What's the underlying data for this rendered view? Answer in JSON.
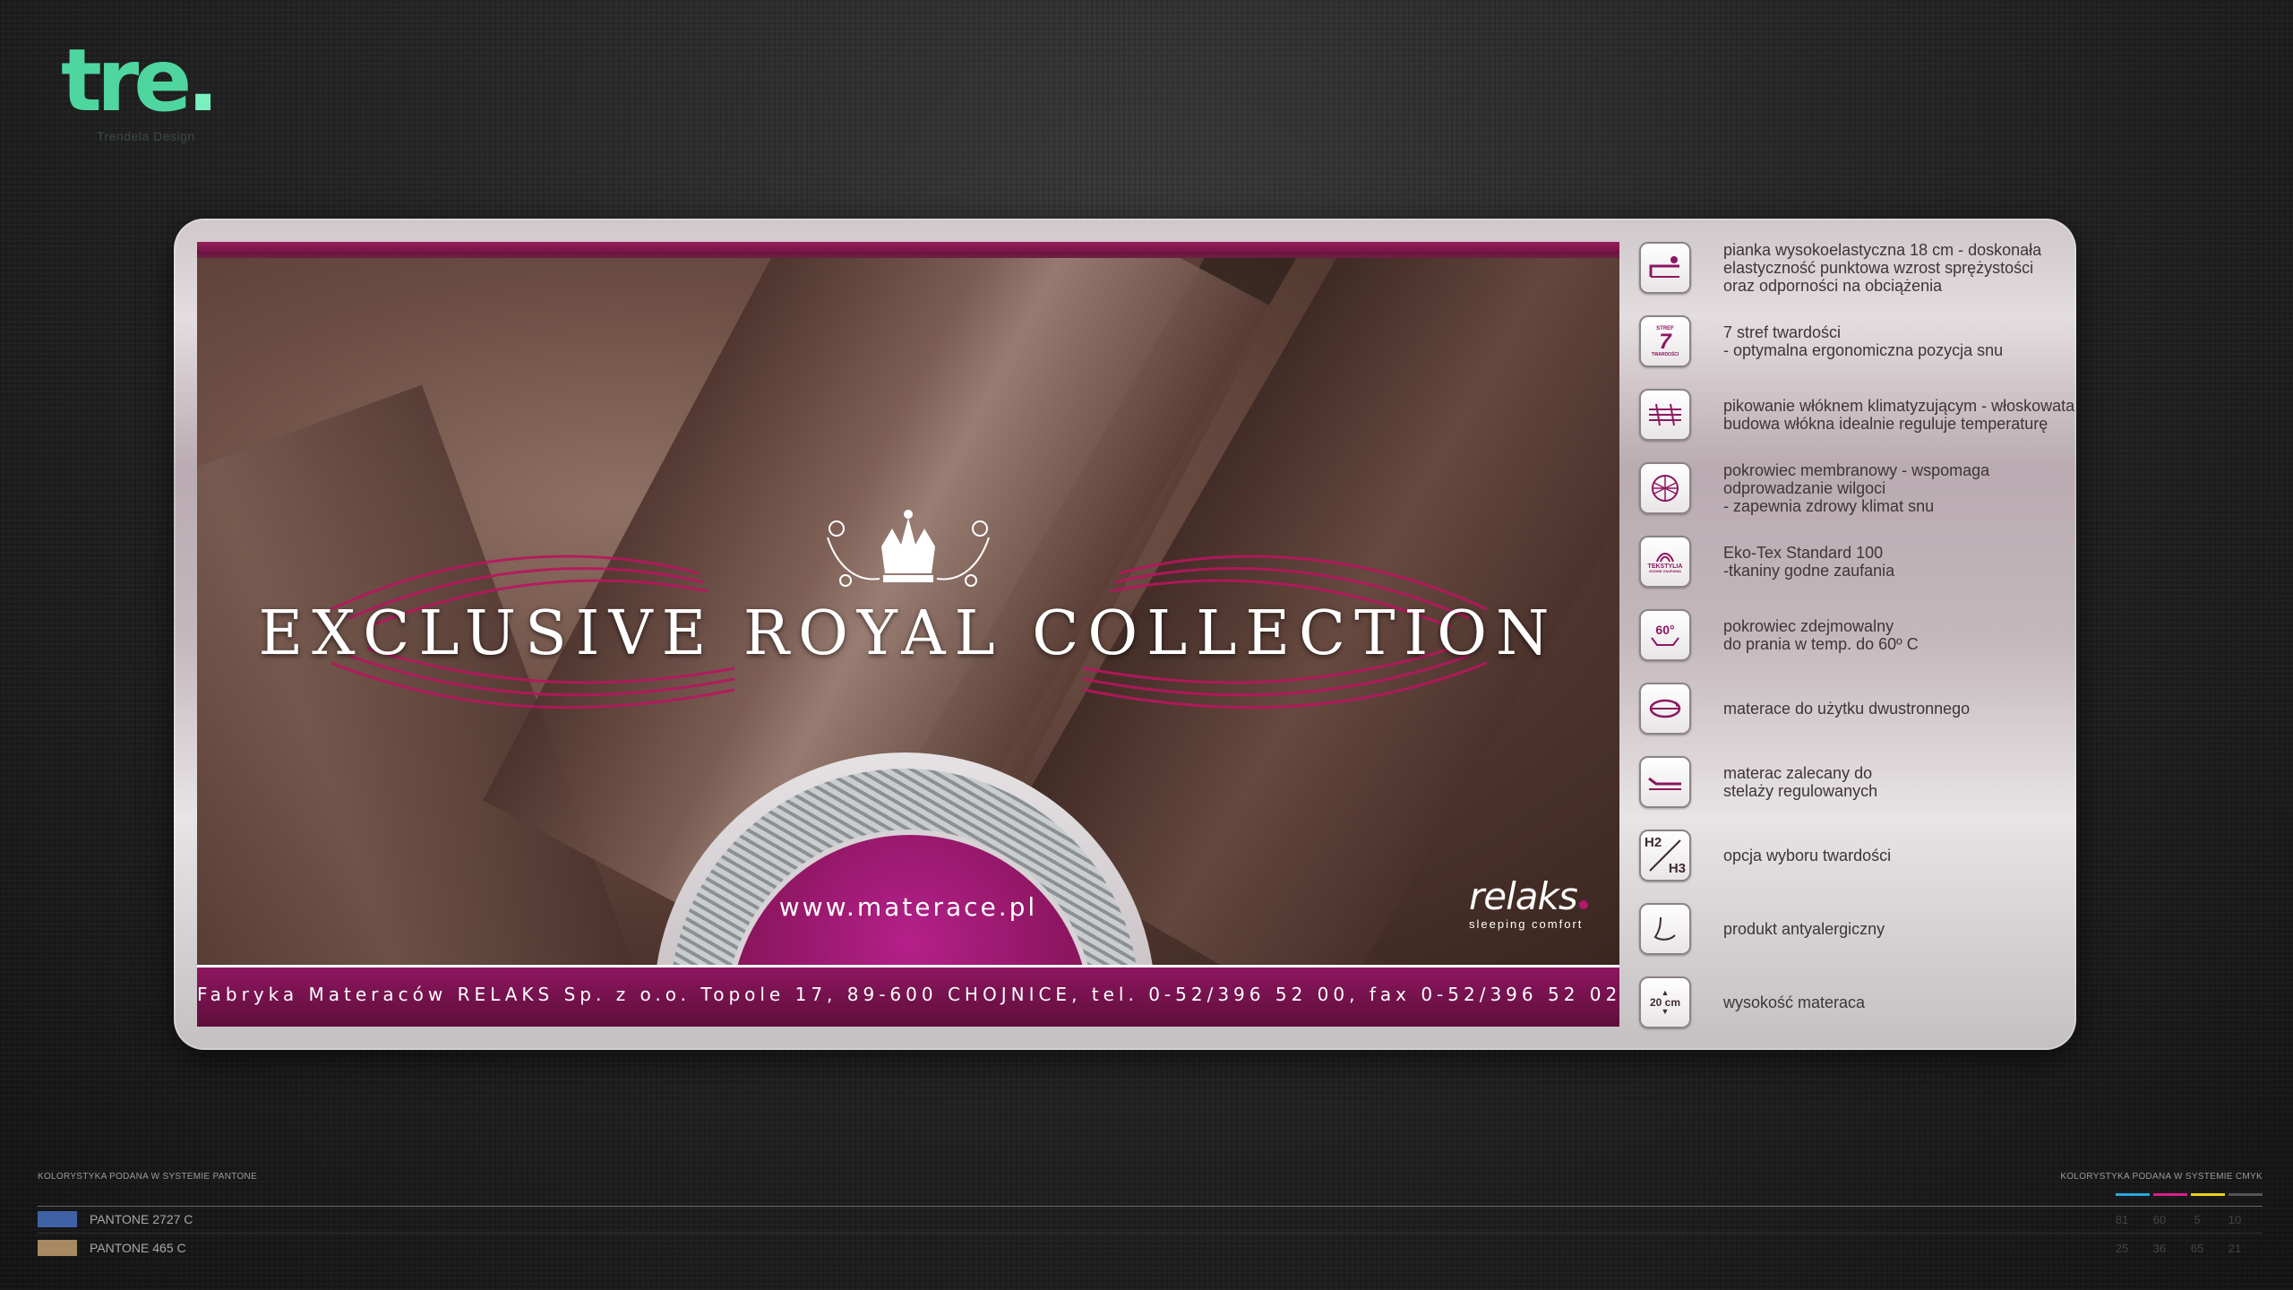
{
  "logo": {
    "mark": "tre",
    "dot": ".",
    "subtitle": "Trendela Design"
  },
  "banner": {
    "headline": "EXCLUSIVE ROYAL COLLECTION",
    "url": "www.materace.pl",
    "brand_name": "relaks",
    "brand_tagline": "sleeping comfort",
    "footer": "Fabryka Materaców RELAKS Sp. z o.o. Topole 17, 89-600 CHOJNICE, tel. 0-52/396 52 00, fax 0-52/396 52 02"
  },
  "features": [
    {
      "icon": "foam-icon",
      "lines": [
        "pianka wysokoelastyczna 18 cm - doskonała",
        "elastyczność punktowa wzrost sprężystości",
        "oraz odporności na obciążenia"
      ]
    },
    {
      "icon": "seven-zones-icon",
      "icon_text": "7",
      "icon_caption_top": "STREF",
      "icon_caption_bottom": "TWARDOŚCI",
      "lines": [
        "7 stref twardości",
        "- optymalna ergonomiczna pozycja snu"
      ]
    },
    {
      "icon": "quilting-fiber-icon",
      "lines": [
        "pikowanie włóknem klimatyzującym - włoskowata",
        "budowa włókna idealnie reguluje temperaturę"
      ]
    },
    {
      "icon": "membrane-cover-icon",
      "lines": [
        "pokrowiec membranowy - wspomaga",
        "odprowadzanie wilgoci",
        "- zapewnia zdrowy klimat snu"
      ]
    },
    {
      "icon": "ekotex-icon",
      "icon_caption_top": "TEKSTYLIA",
      "icon_caption_bottom": "GODNE ZAUFANIA",
      "lines": [
        "Eko-Tex Standard 100",
        "-tkaniny godne zaufania"
      ]
    },
    {
      "icon": "washable-60-icon",
      "icon_text": "60°",
      "lines": [
        "pokrowiec zdejmowalny",
        "do prania w temp. do 60º C"
      ]
    },
    {
      "icon": "two-sided-icon",
      "lines": [
        "materace do użytku dwustronnego"
      ]
    },
    {
      "icon": "adjustable-frame-icon",
      "lines": [
        "materac zalecany do",
        "stelaży regulowanych"
      ]
    },
    {
      "icon": "firmness-h2h3-icon",
      "icon_text_a": "H2",
      "icon_text_b": "H3",
      "lines": [
        "opcja wyboru twardości"
      ]
    },
    {
      "icon": "antiallergic-icon",
      "lines": [
        "produkt antyalergiczny"
      ]
    },
    {
      "icon": "height-20cm-icon",
      "icon_text": "20 cm",
      "lines": [
        "wysokość materaca"
      ]
    }
  ],
  "colors_panel": {
    "pantone_heading": "KOLORYSTYKA PODANA W SYSTEMIE PANTONE",
    "cmyk_heading": "KOLORYSTYKA PODANA W SYSTEMIE CMYK",
    "rows": [
      {
        "swatch": "#3f62a6",
        "label": "PANTONE 2727 C",
        "cmyk": [
          "81",
          "60",
          "5",
          "10"
        ]
      },
      {
        "swatch": "#a88a62",
        "label": "PANTONE 465 C",
        "cmyk": [
          "25",
          "36",
          "65",
          "21"
        ]
      }
    ],
    "cmyk_colors": [
      "#2aa8e0",
      "#d6228a",
      "#e8d21e",
      "#222222"
    ]
  },
  "theme": {
    "accent": "#8d1660",
    "logo_green": "#4fd6a0"
  }
}
